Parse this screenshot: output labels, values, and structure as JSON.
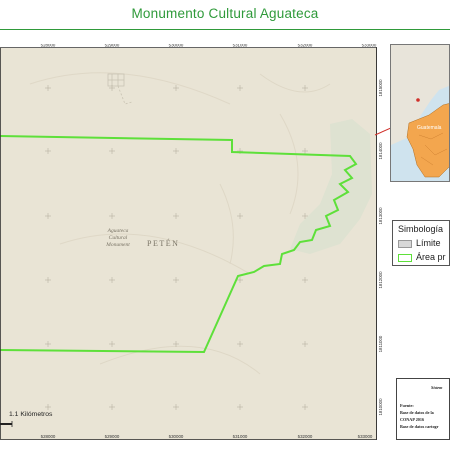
{
  "title": "Monumento Cultural Aguateca",
  "map": {
    "top_ticks": [
      "528000",
      "529000",
      "530000",
      "531000",
      "532000",
      "533000"
    ],
    "bottom_ticks": [
      "528000",
      "529000",
      "530000",
      "531000",
      "532000",
      "533000"
    ],
    "right_ticks": [
      "1815000",
      "1814000",
      "1813000",
      "1812000",
      "1811000",
      "1810000"
    ],
    "place_label_lines": [
      "Aguateca",
      "Cultural",
      "Monument"
    ],
    "department_label": "PETÉN",
    "scale_label": "1.1 Kilómetros",
    "area_color": "#5ee03a",
    "base_color": "#e9e4d5"
  },
  "locator": {
    "label": "Guatemala",
    "highlight_color": "#f3a64e",
    "pointer_color": "#d0302a"
  },
  "legend": {
    "title": "Simbología",
    "items": [
      {
        "label": "Límite",
        "color": "#d8d8d8"
      },
      {
        "label": "Área pr",
        "color": "#5ee03a"
      }
    ]
  },
  "notes": {
    "header": "Sistem",
    "lines": [
      "Fuente:",
      "Base de datos de la",
      "CONAP 2016",
      "Base de datos cartogr"
    ]
  }
}
